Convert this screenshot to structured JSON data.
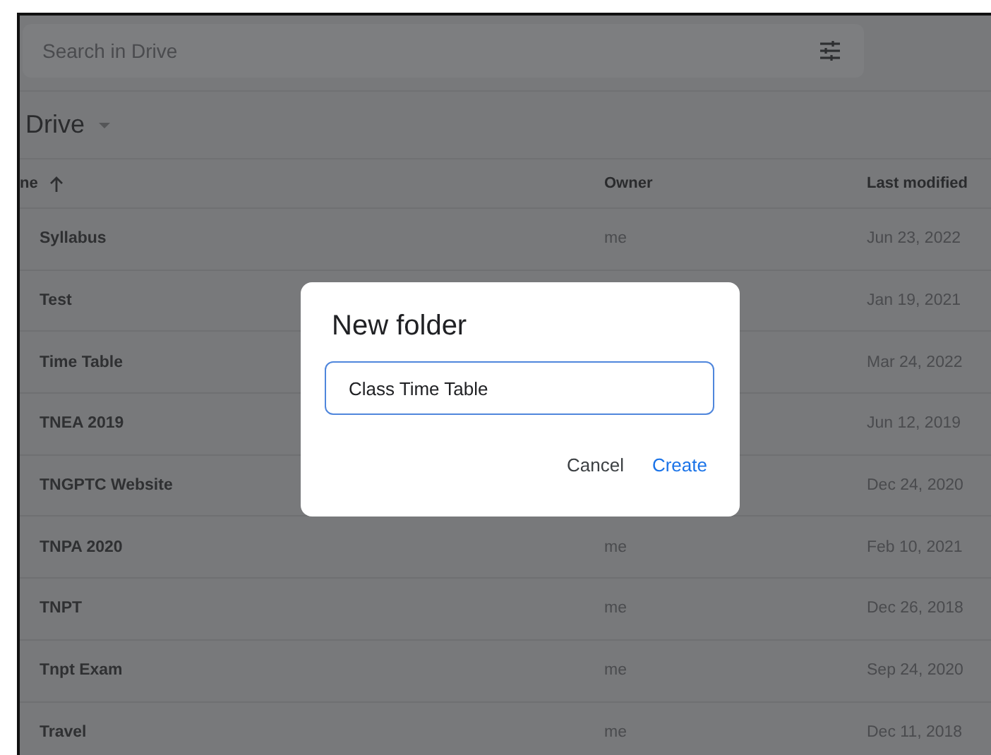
{
  "search": {
    "placeholder": "Search in Drive"
  },
  "location": {
    "label": "Drive"
  },
  "table": {
    "columns": [
      {
        "label": "ne",
        "sorted": true
      },
      {
        "label": "Owner",
        "sorted": false
      },
      {
        "label": "Last modified",
        "sorted": false
      }
    ],
    "rows": [
      {
        "name": "Syllabus",
        "owner": "me",
        "modified": "Jun 23, 2022"
      },
      {
        "name": "Test",
        "modified": "Jan 19, 2021"
      },
      {
        "name": "Time Table",
        "modified": "Mar 24, 2022"
      },
      {
        "name": "TNEA 2019",
        "modified": "Jun 12, 2019"
      },
      {
        "name": "TNGPTC Website",
        "modified": "Dec 24, 2020"
      },
      {
        "name": "TNPA 2020",
        "owner": "me",
        "modified": "Feb 10, 2021"
      },
      {
        "name": "TNPT",
        "owner": "me",
        "modified": "Dec 26, 2018"
      },
      {
        "name": "Tnpt Exam",
        "owner": "me",
        "modified": "Sep 24, 2020"
      },
      {
        "name": "Travel",
        "owner": "me",
        "modified": "Dec 11, 2018"
      }
    ]
  },
  "dialog": {
    "title": "New folder",
    "value": "Class Time Table",
    "buttons": [
      {
        "label": "Cancel",
        "kind": "secondary"
      },
      {
        "label": "Create",
        "kind": "primary"
      }
    ]
  }
}
